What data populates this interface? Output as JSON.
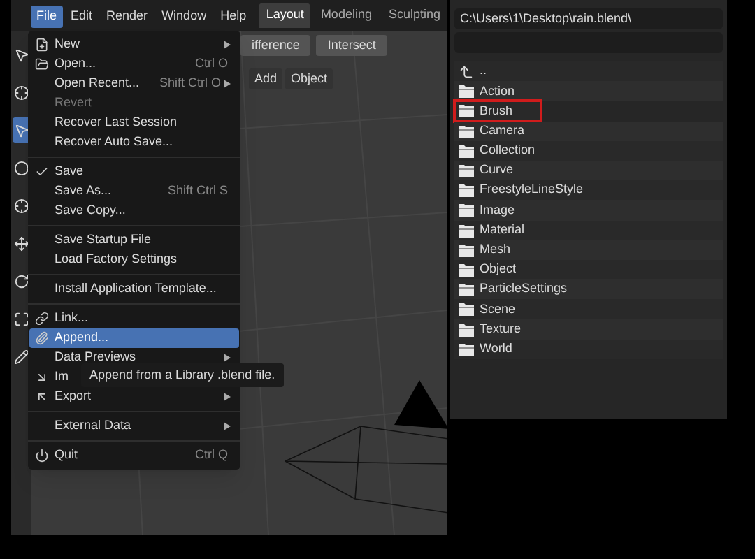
{
  "menubar": {
    "menus": [
      {
        "label": "File",
        "selected": true
      },
      {
        "label": "Edit",
        "selected": false
      },
      {
        "label": "Render",
        "selected": false
      },
      {
        "label": "Window",
        "selected": false
      },
      {
        "label": "Help",
        "selected": false
      }
    ],
    "workspaces": [
      {
        "label": "Layout",
        "selected": true
      },
      {
        "label": "Modeling",
        "selected": false
      },
      {
        "label": "Sculpting",
        "selected": false
      }
    ]
  },
  "boolean_buttons": [
    "ifference",
    "Intersect"
  ],
  "viewport_menus": [
    "Add",
    "Object"
  ],
  "toolbar": {
    "tools": [
      {
        "selected": false
      },
      {
        "selected": false
      },
      {
        "selected": true
      },
      {
        "selected": false
      },
      {
        "selected": false
      },
      {
        "selected": false
      },
      {
        "selected": false
      },
      {
        "selected": false
      },
      {
        "selected": false
      }
    ]
  },
  "file_menu": {
    "items": [
      {
        "kind": "item",
        "label": "New",
        "submenu": true,
        "disabled": false,
        "selected": false
      },
      {
        "kind": "item",
        "label": "Open...",
        "shortcut": "Ctrl O",
        "submenu": false,
        "disabled": false,
        "selected": false
      },
      {
        "kind": "item",
        "label": "Open Recent...",
        "shortcut": "Shift Ctrl O",
        "submenu": true,
        "disabled": false,
        "selected": false
      },
      {
        "kind": "item",
        "label": "Revert",
        "submenu": false,
        "disabled": true,
        "selected": false
      },
      {
        "kind": "item",
        "label": "Recover Last Session",
        "submenu": false,
        "disabled": false,
        "selected": false
      },
      {
        "kind": "item",
        "label": "Recover Auto Save...",
        "submenu": false,
        "disabled": false,
        "selected": false
      },
      {
        "kind": "separator"
      },
      {
        "kind": "item",
        "label": "Save",
        "submenu": false,
        "disabled": false,
        "selected": false
      },
      {
        "kind": "item",
        "label": "Save As...",
        "shortcut": "Shift Ctrl S",
        "submenu": false,
        "disabled": false,
        "selected": false
      },
      {
        "kind": "item",
        "label": "Save Copy...",
        "submenu": false,
        "disabled": false,
        "selected": false
      },
      {
        "kind": "separator"
      },
      {
        "kind": "item",
        "label": "Save Startup File",
        "submenu": false,
        "disabled": false,
        "selected": false
      },
      {
        "kind": "item",
        "label": "Load Factory Settings",
        "submenu": false,
        "disabled": false,
        "selected": false
      },
      {
        "kind": "separator"
      },
      {
        "kind": "item",
        "label": "Install Application Template...",
        "submenu": false,
        "disabled": false,
        "selected": false
      },
      {
        "kind": "separator"
      },
      {
        "kind": "item",
        "label": "Link...",
        "submenu": false,
        "disabled": false,
        "selected": false
      },
      {
        "kind": "item",
        "label": "Append...",
        "submenu": false,
        "disabled": false,
        "selected": true
      },
      {
        "kind": "item",
        "label": "Data Previews",
        "submenu": true,
        "disabled": false,
        "selected": false
      },
      {
        "kind": "item",
        "label": "Im",
        "submenu": false,
        "disabled": false,
        "selected": false
      },
      {
        "kind": "item",
        "label": "Export",
        "submenu": true,
        "disabled": false,
        "selected": false
      },
      {
        "kind": "separator"
      },
      {
        "kind": "item",
        "label": "External Data",
        "submenu": true,
        "disabled": false,
        "selected": false
      },
      {
        "kind": "separator"
      },
      {
        "kind": "item",
        "label": "Quit",
        "shortcut": "Ctrl Q",
        "submenu": false,
        "disabled": false,
        "selected": false
      }
    ]
  },
  "tooltip": "Append from a Library .blend file.",
  "file_browser": {
    "path": "C:\\Users\\1\\Desktop\\rain.blend\\",
    "items": [
      {
        "kind": "parent",
        "label": "..",
        "marked": false
      },
      {
        "kind": "folder",
        "label": "Action",
        "marked": false
      },
      {
        "kind": "folder",
        "label": "Brush",
        "marked": true
      },
      {
        "kind": "folder",
        "label": "Camera",
        "marked": false
      },
      {
        "kind": "folder",
        "label": "Collection",
        "marked": false
      },
      {
        "kind": "folder",
        "label": "Curve",
        "marked": false
      },
      {
        "kind": "folder",
        "label": "FreestyleLineStyle",
        "marked": false
      },
      {
        "kind": "folder",
        "label": "Image",
        "marked": false
      },
      {
        "kind": "folder",
        "label": "Material",
        "marked": false
      },
      {
        "kind": "folder",
        "label": "Mesh",
        "marked": false
      },
      {
        "kind": "folder",
        "label": "Object",
        "marked": false
      },
      {
        "kind": "folder",
        "label": "ParticleSettings",
        "marked": false
      },
      {
        "kind": "folder",
        "label": "Scene",
        "marked": false
      },
      {
        "kind": "folder",
        "label": "Texture",
        "marked": false
      },
      {
        "kind": "folder",
        "label": "World",
        "marked": false
      }
    ]
  }
}
